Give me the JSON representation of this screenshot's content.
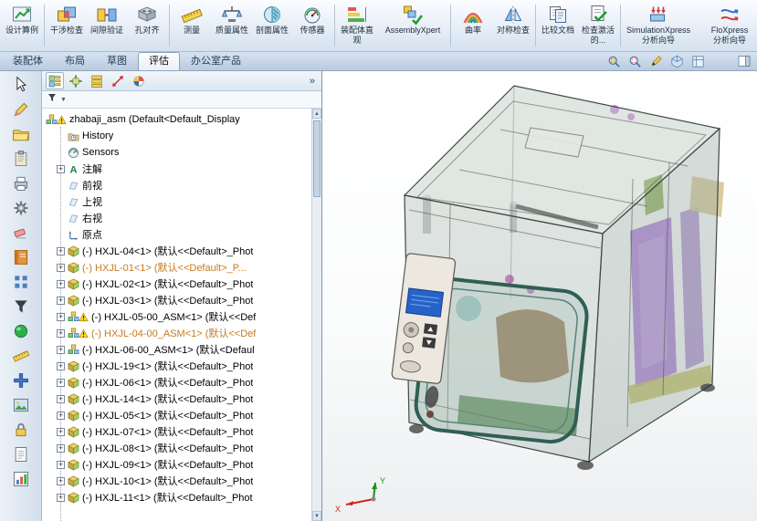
{
  "app": {
    "name": "SolidWorks assembly window"
  },
  "ribbon": {
    "buttons": [
      {
        "label": "设计算例",
        "icon": "design-study"
      },
      {
        "label": "干涉检查",
        "icon": "interference-detection"
      },
      {
        "label": "间隙验证",
        "icon": "clearance-verification"
      },
      {
        "label": "孔对齐",
        "icon": "hole-alignment"
      },
      {
        "label": "测量",
        "icon": "measure"
      },
      {
        "label": "质量属性",
        "icon": "mass-properties"
      },
      {
        "label": "剖面属性",
        "icon": "section-properties"
      },
      {
        "label": "传感器",
        "icon": "sensors"
      },
      {
        "label": "装配体直观",
        "icon": "assembly-visualization"
      },
      {
        "label": "AssemblyXpert",
        "icon": "assembly-xpert",
        "wide": true
      },
      {
        "label": "曲率",
        "icon": "curvature"
      },
      {
        "label": "对称检查",
        "icon": "symmetry-check"
      },
      {
        "label": "比较文档",
        "icon": "compare-documents"
      },
      {
        "label": "检查激活的...",
        "icon": "check-active-document"
      },
      {
        "label": "SimulationXpress\n分析向导",
        "icon": "simulationxpress",
        "wide": true
      },
      {
        "label": "FloXpress\n分析向导",
        "icon": "floxpress",
        "wide": true
      }
    ],
    "separators_after": [
      0,
      3,
      7,
      9,
      11,
      13
    ]
  },
  "tabs": {
    "items": [
      {
        "label": "装配体",
        "active": false
      },
      {
        "label": "布局",
        "active": false
      },
      {
        "label": "草图",
        "active": false
      },
      {
        "label": "评估",
        "active": true
      },
      {
        "label": "办公室产品",
        "active": false
      }
    ]
  },
  "headsup": {
    "icons": [
      "zoom-to-fit",
      "zoom-to-area",
      "view-settings",
      "display-style",
      "view-orientation"
    ],
    "right_icon": "task-pane"
  },
  "left_toolbar": {
    "icons": [
      "select-arrow",
      "sketch-pencil",
      "open-folder",
      "clipboard",
      "printer",
      "gear",
      "eraser",
      "manual-book",
      "grid-pattern",
      "funnel",
      "render-sphere",
      "ruler",
      "add-plus",
      "image-mountain",
      "lock",
      "note",
      "bar-chart"
    ]
  },
  "panel": {
    "tabs": [
      "feature-manager",
      "property-manager",
      "configuration-manager",
      "dimxpert",
      "display-manager"
    ],
    "overflow": "»",
    "filter_caret": "▼",
    "scroll_up": "▲",
    "scroll_down": "▼",
    "tree": {
      "root": {
        "label": "zhabaji_asm  (Default<Default_Display",
        "icon": "asm",
        "warning": true
      },
      "items": [
        {
          "label": "History",
          "icon": "history"
        },
        {
          "label": "Sensors",
          "icon": "sensors-tree"
        },
        {
          "label": "注解",
          "icon": "annotations",
          "plus": true
        },
        {
          "label": "前视",
          "icon": "plane"
        },
        {
          "label": "上视",
          "icon": "plane"
        },
        {
          "label": "右视",
          "icon": "plane"
        },
        {
          "label": "原点",
          "icon": "origin"
        },
        {
          "label": "(-) HXJL-04<1> (默认<<Default>_Phot",
          "icon": "part",
          "plus": true
        },
        {
          "label": "(-) HXJL-01<1> (默认<<Default>_P...",
          "icon": "part",
          "plus": true,
          "highlight": true
        },
        {
          "label": "(-) HXJL-02<1> (默认<<Default>_Phot",
          "icon": "part",
          "plus": true
        },
        {
          "label": "(-) HXJL-03<1> (默认<<Default>_Phot",
          "icon": "part",
          "plus": true
        },
        {
          "label": "(-) HXJL-05-00_ASM<1> (默认<<Def",
          "icon": "asm",
          "plus": true,
          "warning": true
        },
        {
          "label": "(-) HXJL-04-00_ASM<1> (默认<<Def",
          "icon": "asm",
          "plus": true,
          "warning": true,
          "highlight": true
        },
        {
          "label": "(-) HXJL-06-00_ASM<1> (默认<Defaul",
          "icon": "asm",
          "plus": true
        },
        {
          "label": "(-) HXJL-19<1> (默认<<Default>_Phot",
          "icon": "part",
          "plus": true
        },
        {
          "label": "(-) HXJL-06<1> (默认<<Default>_Phot",
          "icon": "part",
          "plus": true
        },
        {
          "label": "(-) HXJL-14<1> (默认<<Default>_Phot",
          "icon": "part",
          "plus": true
        },
        {
          "label": "(-) HXJL-05<1> (默认<<Default>_Phot",
          "icon": "part",
          "plus": true
        },
        {
          "label": "(-) HXJL-07<1> (默认<<Default>_Phot",
          "icon": "part",
          "plus": true
        },
        {
          "label": "(-) HXJL-08<1> (默认<<Default>_Phot",
          "icon": "part",
          "plus": true
        },
        {
          "label": "(-) HXJL-09<1> (默认<<Default>_Phot",
          "icon": "part",
          "plus": true
        },
        {
          "label": "(-) HXJL-10<1> (默认<<Default>_Phot",
          "icon": "part",
          "plus": true
        },
        {
          "label": "(-) HXJL-11<1> (默认<<Default>_Phot",
          "icon": "part",
          "plus": true
        }
      ]
    }
  },
  "viewport": {
    "triad": {
      "x": "X",
      "y": "Y"
    }
  },
  "colors": {
    "highlight_text": "#c8791f",
    "warning_yellow": "#ffd92b",
    "tab_active_bg": "#eef4fa",
    "axis_x": "#cc2222",
    "axis_y": "#1d8f1d"
  }
}
